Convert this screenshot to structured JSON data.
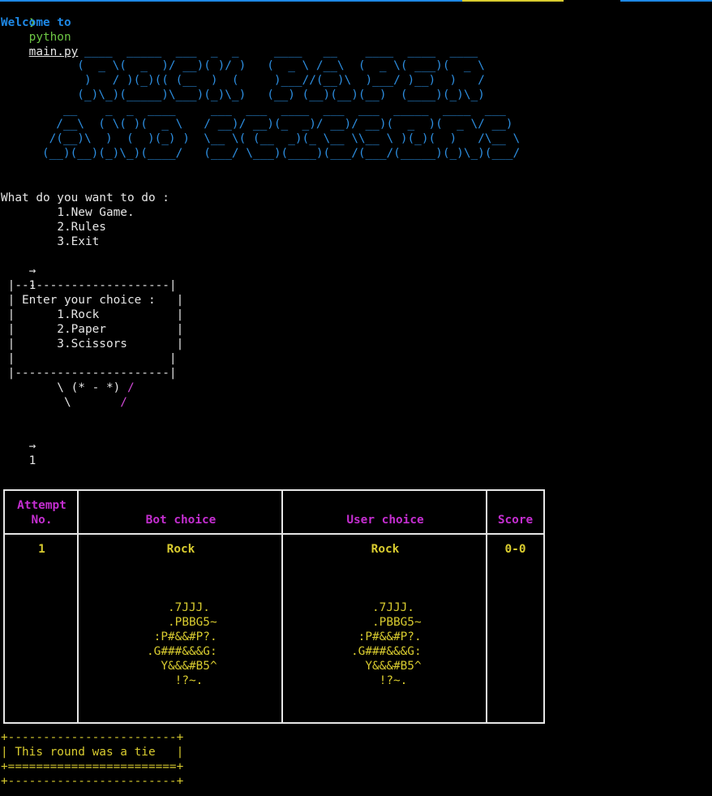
{
  "top_bar": {
    "colors": {
      "blue": "#1e88e5",
      "yellow": "#d8cb2f"
    }
  },
  "command": {
    "prompt_symbol": "❯",
    "program": "python",
    "arg": "main.py"
  },
  "welcome_text": "Welcome to",
  "banner_ascii": [
    "            ____  _____  ___  _  _     ____   __    ____  ____  ____ ",
    "           (  _ \\(  _  )/ __)( )/ )   (  _ \\ /__\\  (  _ \\( ___)(  _ \\",
    "            )   / )(_)(( (__  )  (     )___//(__)\\  )___/ )__)  )   /",
    "           (_)\\_)(_____)\\___)(_)\\_)   (__) (__)(__)(__)  (____)(_)\\_)",
    "         __    _  _  ____     ___  ___  ____  ___  ___  _____  ____  ___ ",
    "        /__\\  ( \\( )(  _ \\   / __)/ __)(_  _)/ __)/ __)(  _  )(  _ \\/ __)",
    "       /(__)\\  )  (  )(_) )  \\__ \\( (__  _)(_ \\__ \\\\__ \\ )(_)(  )   /\\__ \\",
    "      (__)(__)(_)\\_)(____/   (___/ \\___)(____)(___/(___/(_____)(_)\\_)(___/"
  ],
  "main_menu": {
    "question": "What do you want to do :",
    "options": [
      "1.New Game.",
      "2.Rules",
      "3.Exit"
    ],
    "input_arrow": "→",
    "input_value": "1"
  },
  "choice_menu": {
    "border_top": " |----------------------|",
    "prompt": " | Enter your choice :   |",
    "options": [
      " |      1.Rock           |",
      " |      2.Paper          |",
      " |      3.Scissors       |"
    ],
    "blank_line": " |                      |",
    "border_bottom": " |----------------------|",
    "mascot_line1_a": "        \\ (* - *) ",
    "mascot_line1_b": "/",
    "mascot_line2_a": "         \\       ",
    "mascot_line2_b": "/",
    "input_arrow": "→",
    "input_value": "1"
  },
  "table": {
    "headers": {
      "attempt": "Attempt\nNo.",
      "bot": "Bot choice",
      "user": "User choice",
      "score": "Score"
    },
    "row": {
      "attempt": "1",
      "bot_choice": "Rock",
      "user_choice": "Rock",
      "score": "0-0"
    },
    "rock_art": [
      "   .7JJJ.",
      "   .PBBG5~",
      " :P#&&#P?.",
      ".G###&&&G:",
      "  Y&&&#B5^",
      "    !?~."
    ]
  },
  "result_box": {
    "top": "+------------------------+",
    "message": "| This round was a tie   |",
    "middle": "+========================+",
    "bottom": "+------------------------+"
  }
}
